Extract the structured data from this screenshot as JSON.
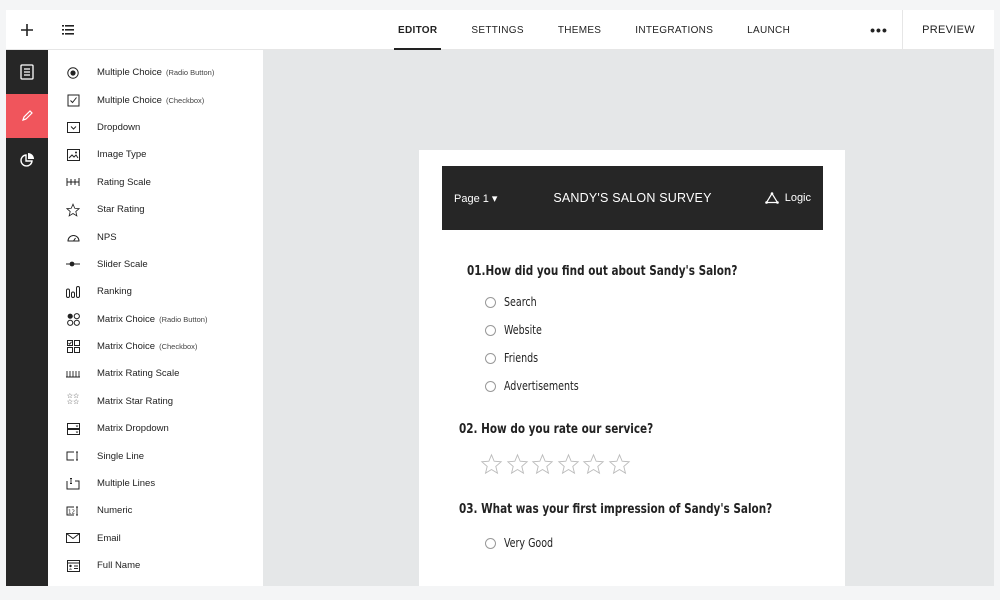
{
  "topbar": {
    "add_icon": "plus-icon",
    "menu_icon": "list-icon",
    "tabs": [
      {
        "label": "EDITOR",
        "active": true
      },
      {
        "label": "SETTINGS",
        "active": false
      },
      {
        "label": "THEMES",
        "active": false
      },
      {
        "label": "INTEGRATIONS",
        "active": false
      },
      {
        "label": "LAUNCH",
        "active": false
      }
    ],
    "more_label": "•••",
    "preview_label": "PREVIEW"
  },
  "rail": {
    "items": [
      {
        "icon": "document-icon",
        "active": false
      },
      {
        "icon": "pencil-icon",
        "active": true
      },
      {
        "icon": "pie-chart-icon",
        "active": false
      }
    ],
    "accent_color": "#f0555c"
  },
  "question_types": [
    {
      "label": "Multiple Choice",
      "sub": "(Radio Button)",
      "icon": "radio-icon"
    },
    {
      "label": "Multiple Choice",
      "sub": "(Checkbox)",
      "icon": "checkbox-icon"
    },
    {
      "label": "Dropdown",
      "sub": "",
      "icon": "dropdown-icon"
    },
    {
      "label": "Image Type",
      "sub": "",
      "icon": "image-icon"
    },
    {
      "label": "Rating Scale",
      "sub": "",
      "icon": "rating-scale-icon"
    },
    {
      "label": "Star Rating",
      "sub": "",
      "icon": "star-icon"
    },
    {
      "label": "NPS",
      "sub": "",
      "icon": "gauge-icon"
    },
    {
      "label": "Slider Scale",
      "sub": "",
      "icon": "slider-icon"
    },
    {
      "label": "Ranking",
      "sub": "",
      "icon": "ranking-icon"
    },
    {
      "label": "Matrix Choice",
      "sub": "(Radio Button)",
      "icon": "matrix-radio-icon"
    },
    {
      "label": "Matrix Choice",
      "sub": "(Checkbox)",
      "icon": "matrix-checkbox-icon"
    },
    {
      "label": "Matrix Rating Scale",
      "sub": "",
      "icon": "matrix-rating-icon"
    },
    {
      "label": "Matrix Star Rating",
      "sub": "",
      "icon": "matrix-star-icon"
    },
    {
      "label": "Matrix Dropdown",
      "sub": "",
      "icon": "matrix-dropdown-icon"
    },
    {
      "label": "Single Line",
      "sub": "",
      "icon": "single-line-icon"
    },
    {
      "label": "Multiple Lines",
      "sub": "",
      "icon": "multiple-lines-icon"
    },
    {
      "label": "Numeric",
      "sub": "",
      "icon": "numeric-icon"
    },
    {
      "label": "Email",
      "sub": "",
      "icon": "email-icon"
    },
    {
      "label": "Full Name",
      "sub": "",
      "icon": "full-name-icon"
    }
  ],
  "survey": {
    "page_label": "Page 1 ▾",
    "title": "SANDY'S SALON SURVEY",
    "logic_label": "Logic",
    "questions": [
      {
        "label": "01.How did you find out about Sandy's Salon?",
        "options": [
          "Search",
          "Website",
          "Friends",
          "Advertisements"
        ]
      },
      {
        "label": "02. How do you rate our service?",
        "stars": 6
      },
      {
        "label": "03. What was your first impression of Sandy's Salon?",
        "options": [
          "Very Good"
        ]
      }
    ]
  }
}
